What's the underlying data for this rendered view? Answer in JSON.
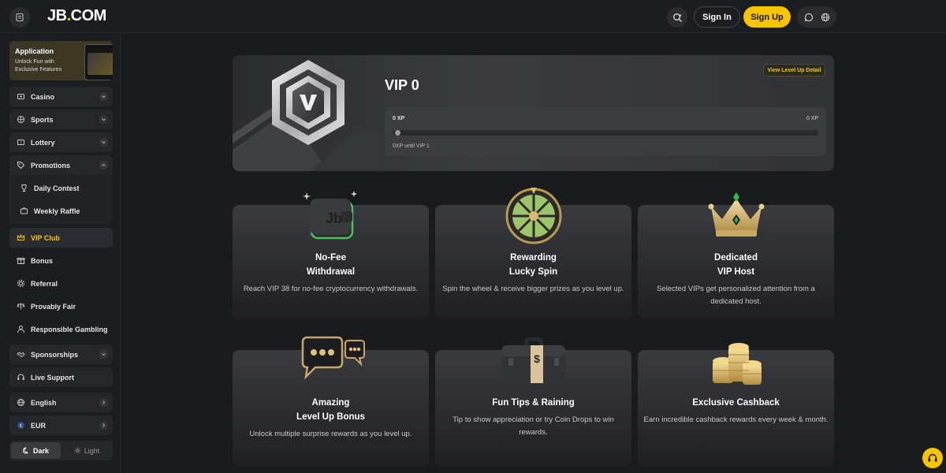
{
  "header": {
    "logo_main": "JB",
    "logo_dot": ".",
    "logo_tld": "COM",
    "signin_label": "Sign In",
    "signup_label": "Sign Up",
    "icons": [
      "menu-icon",
      "search-icon",
      "chat-icon",
      "globe-icon"
    ]
  },
  "sidebar": {
    "app_card": {
      "title": "Application",
      "subtitle": "Unlock Fun with Exclusive Features"
    },
    "items": [
      {
        "label": "Casino",
        "icon": "casino-icon"
      },
      {
        "label": "Sports",
        "icon": "sports-icon"
      },
      {
        "label": "Lottery",
        "icon": "lottery-icon"
      },
      {
        "label": "Promotions",
        "icon": "tag-icon"
      },
      {
        "label": "Daily Contest",
        "icon": "trophy-icon"
      },
      {
        "label": "Weekly Raffle",
        "icon": "raffle-icon"
      },
      {
        "label": "VIP Club",
        "icon": "crown-icon"
      },
      {
        "label": "Bonus",
        "icon": "gift-icon"
      },
      {
        "label": "Referral",
        "icon": "gear-icon"
      },
      {
        "label": "Provably Fair",
        "icon": "scale-icon"
      },
      {
        "label": "Responsible Gambling",
        "icon": "person-icon"
      },
      {
        "label": "Sponsorships",
        "icon": "handshake-icon"
      },
      {
        "label": "Live Support",
        "icon": "headset-icon"
      },
      {
        "label": "English",
        "icon": "globe-icon"
      },
      {
        "label": "EUR",
        "icon": "euro-icon"
      }
    ],
    "theme": {
      "dark_label": "Dark",
      "light_label": "Light",
      "selected": "Dark"
    }
  },
  "vip": {
    "title": "VIP 0",
    "detail_label": "View Level Up Detail",
    "xp_current": "0 XP",
    "xp_target": "0 XP",
    "progress": 0,
    "until_text": "0XP until VIP 1"
  },
  "features": [
    {
      "title1": "No-Fee",
      "title2": "Withdrawal",
      "desc": "Reach VIP 38 for no-fee cryptocurrency withdrawals."
    },
    {
      "title1": "Rewarding",
      "title2": "Lucky Spin",
      "desc": "Spin the wheel & receive bigger prizes as you level up."
    },
    {
      "title1": "Dedicated",
      "title2": "VIP Host",
      "desc": "Selected VIPs get personalized attention from a dedicated host."
    },
    {
      "title1": "Amazing",
      "title2": "Level Up Bonus",
      "desc": "Unlock multiple surprise rewards as you level up."
    },
    {
      "title1": "Fun Tips & Raining",
      "title2": "",
      "desc": "Tip to show appreciation or try Coin Drops to win rewards."
    },
    {
      "title1": "Exclusive Cashback",
      "title2": "",
      "desc": "Earn incredible cashback rewards every week & month."
    }
  ],
  "colors": {
    "accent": "#f7c500",
    "background": "#1a1b1d",
    "card": "#2b2c30"
  }
}
